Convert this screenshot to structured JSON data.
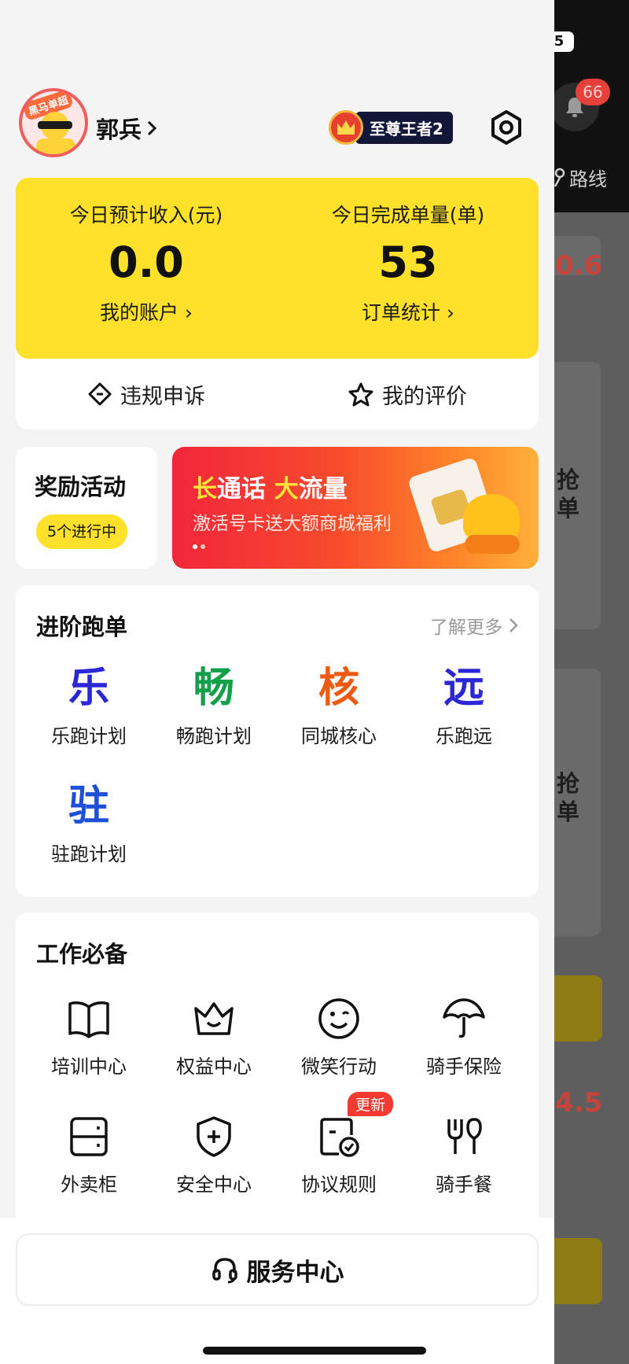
{
  "background_app": {
    "status_text": "5",
    "notification_count": "66",
    "route_label": "路线",
    "amount_top": "0.6",
    "amount_bottom": "4.5",
    "grab_label_1": "抢单",
    "grab_label_2": "抢单"
  },
  "profile": {
    "avatar_badge": "黑马单超",
    "name": "郭兵",
    "vip_label": "至尊王者2"
  },
  "earnings": {
    "income_title": "今日预计收入(元)",
    "income_value": "0.0",
    "account_link": "我的账户",
    "orders_title": "今日完成单量(单)",
    "orders_value": "53",
    "orders_link": "订单统计",
    "appeal_label": "违规申诉",
    "rating_label": "我的评价"
  },
  "reward": {
    "title": "奖励活动",
    "pill": "5个进行中"
  },
  "banner": {
    "title_part1": "长",
    "title_part2": "通话 ",
    "title_part3": "大",
    "title_part4": "流量",
    "subtitle": "激活号卡送大额商城福利"
  },
  "advanced": {
    "title": "进阶跑单",
    "more": "了解更多",
    "items": [
      {
        "glyph": "乐",
        "label": "乐跑计划",
        "color": "#2b27d6"
      },
      {
        "glyph": "畅",
        "label": "畅跑计划",
        "color": "#14a04a"
      },
      {
        "glyph": "核",
        "label": "同城核心",
        "color": "#ee5a12"
      },
      {
        "glyph": "远",
        "label": "乐跑远",
        "color": "#2b27d6"
      },
      {
        "glyph": "驻",
        "label": "驻跑计划",
        "color": "#1d50d6"
      }
    ]
  },
  "work": {
    "title": "工作必备",
    "items": [
      {
        "label": "培训中心",
        "icon": "book-icon"
      },
      {
        "label": "权益中心",
        "icon": "crown-icon"
      },
      {
        "label": "微笑行动",
        "icon": "smile-icon"
      },
      {
        "label": "骑手保险",
        "icon": "umbrella-icon"
      },
      {
        "label": "外卖柜",
        "icon": "locker-icon"
      },
      {
        "label": "安全中心",
        "icon": "shield-icon"
      },
      {
        "label": "协议规则",
        "icon": "document-check-icon",
        "badge": "更新"
      },
      {
        "label": "骑手餐",
        "icon": "cutlery-icon"
      }
    ]
  },
  "footer": {
    "service_label": "服务中心"
  },
  "colors": {
    "accent_yellow": "#ffe02a",
    "badge_red": "#f23a30",
    "banner_red": "#f2263b"
  }
}
